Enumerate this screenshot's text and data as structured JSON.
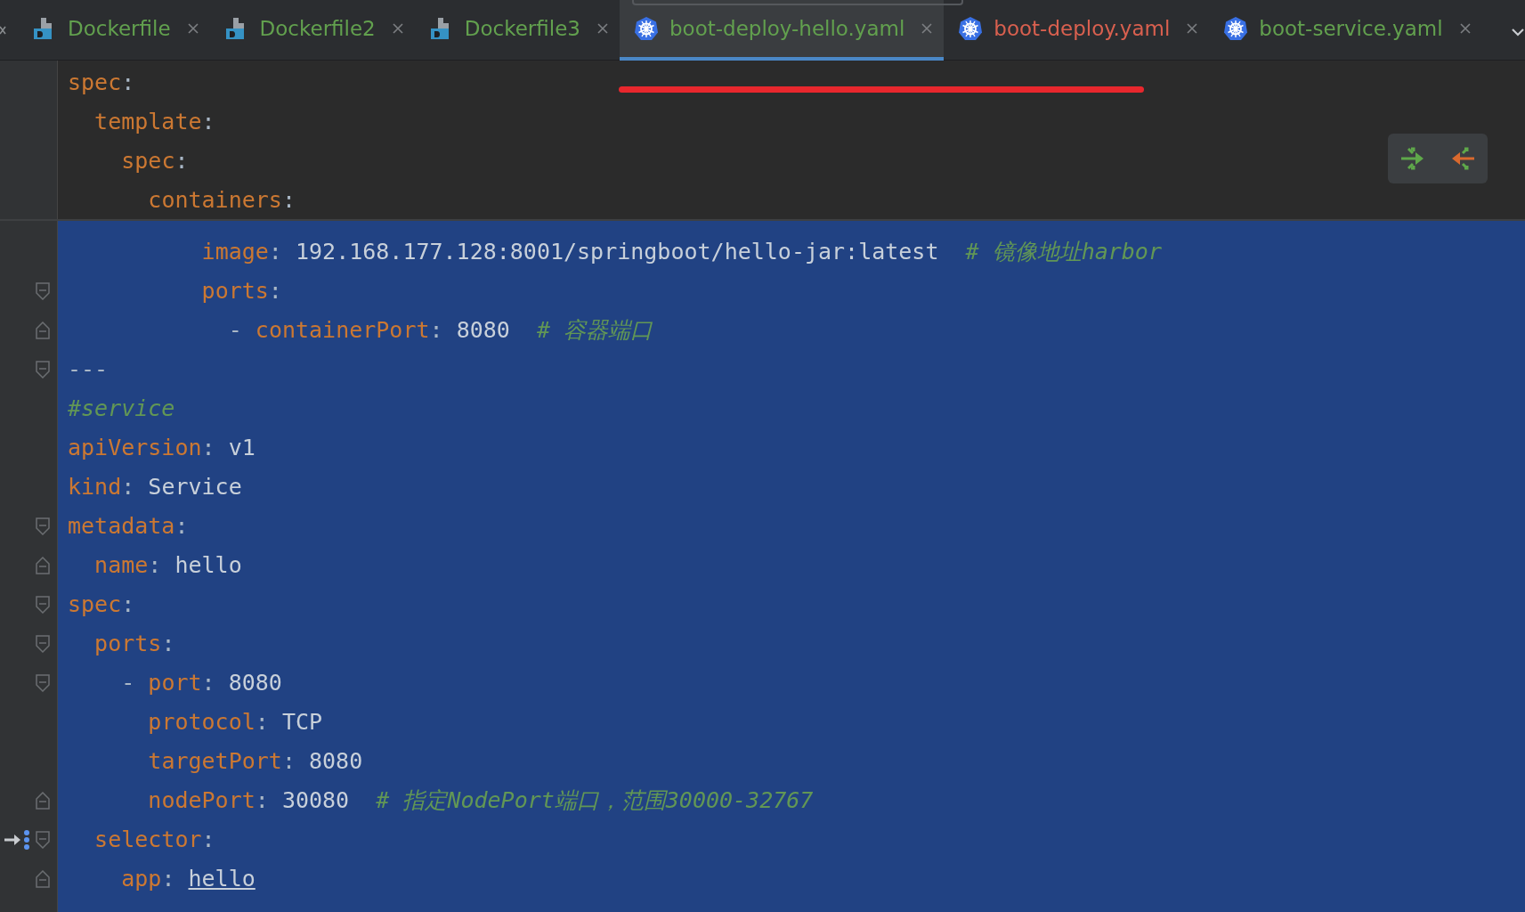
{
  "tabs": [
    {
      "label": "Dockerfile",
      "kind": "docker",
      "color": "#62a04e",
      "selected": false
    },
    {
      "label": "Dockerfile2",
      "kind": "docker",
      "color": "#62a04e",
      "selected": false
    },
    {
      "label": "Dockerfile3",
      "kind": "docker",
      "color": "#62a04e",
      "selected": false
    },
    {
      "label": "boot-deploy-hello.yaml",
      "kind": "kubernetes",
      "color": "#62a04e",
      "selected": true
    },
    {
      "label": "boot-deploy.yaml",
      "kind": "kubernetes",
      "color": "#d9604f",
      "selected": false
    },
    {
      "label": "boot-service.yaml",
      "kind": "kubernetes",
      "color": "#62a04e",
      "selected": false
    }
  ],
  "sticky_header": [
    {
      "tokens": [
        {
          "kind": "key",
          "text": "spec"
        },
        {
          "kind": "punct",
          "text": ":"
        }
      ],
      "children": [
        {
          "tokens": [
            {
              "kind": "key",
              "text": "template"
            },
            {
              "kind": "punct",
              "text": ":"
            }
          ],
          "children": [
            {
              "tokens": [
                {
                  "kind": "key",
                  "text": "spec"
                },
                {
                  "kind": "punct",
                  "text": ":"
                }
              ],
              "children": [
                {
                  "tokens": [
                    {
                      "kind": "key",
                      "text": "containers"
                    },
                    {
                      "kind": "punct",
                      "text": ":"
                    }
                  ]
                }
              ]
            }
          ]
        }
      ]
    }
  ],
  "scrolled_lines": [
    {
      "fold_start": false,
      "fold_end": false,
      "gutter_mark": false,
      "tokens": [
        {
          "kind": "key",
          "text": "image"
        },
        {
          "kind": "punct",
          "text": ":"
        },
        {
          "kind": "value",
          "text": "192.168.177.128:8001/springboot/hello-jar:latest"
        },
        {
          "kind": "comment",
          "text": "# 镜像地址harbor"
        }
      ]
    },
    {
      "fold_start": true,
      "fold_end": false,
      "gutter_mark": false,
      "tokens": [
        {
          "kind": "key",
          "text": "ports"
        },
        {
          "kind": "punct",
          "text": ":"
        }
      ],
      "children": [
        {
          "fold_start": false,
          "fold_end": true,
          "gutter_mark": false,
          "tokens": [
            {
              "kind": "punct",
              "text": "-"
            },
            {
              "kind": "key",
              "text": "containerPort"
            },
            {
              "kind": "punct",
              "text": ":"
            },
            {
              "kind": "value",
              "text": "8080"
            },
            {
              "kind": "comment",
              "text": "# 容器端口"
            }
          ]
        }
      ]
    }
  ],
  "code_lines": [
    {
      "fold_start": true,
      "fold_end": false,
      "gutter_mark": false,
      "tokens": [
        {
          "kind": "punct",
          "text": "---"
        }
      ]
    },
    {
      "fold_start": false,
      "fold_end": false,
      "gutter_mark": false,
      "tokens": [
        {
          "kind": "comment",
          "text": "#service"
        }
      ]
    },
    {
      "fold_start": false,
      "fold_end": false,
      "gutter_mark": false,
      "tokens": [
        {
          "kind": "key",
          "text": "apiVersion"
        },
        {
          "kind": "punct",
          "text": ":"
        },
        {
          "kind": "value",
          "text": "v1"
        }
      ]
    },
    {
      "fold_start": false,
      "fold_end": false,
      "gutter_mark": false,
      "tokens": [
        {
          "kind": "key",
          "text": "kind"
        },
        {
          "kind": "punct",
          "text": ":"
        },
        {
          "kind": "value",
          "text": "Service"
        }
      ]
    },
    {
      "fold_start": true,
      "fold_end": false,
      "gutter_mark": false,
      "tokens": [
        {
          "kind": "key",
          "text": "metadata"
        },
        {
          "kind": "punct",
          "text": ":"
        }
      ],
      "children": [
        {
          "fold_start": false,
          "fold_end": true,
          "gutter_mark": false,
          "tokens": [
            {
              "kind": "key",
              "text": "name"
            },
            {
              "kind": "punct",
              "text": ":"
            },
            {
              "kind": "value",
              "text": "hello"
            }
          ]
        }
      ]
    },
    {
      "fold_start": true,
      "fold_end": false,
      "gutter_mark": false,
      "tokens": [
        {
          "kind": "key",
          "text": "spec"
        },
        {
          "kind": "punct",
          "text": ":"
        }
      ],
      "children": [
        {
          "fold_start": true,
          "fold_end": false,
          "gutter_mark": false,
          "tokens": [
            {
              "kind": "key",
              "text": "ports"
            },
            {
              "kind": "punct",
              "text": ":"
            }
          ],
          "children": [
            {
              "fold_start": true,
              "fold_end": false,
              "gutter_mark": false,
              "tokens": [
                {
                  "kind": "punct",
                  "text": "-"
                },
                {
                  "kind": "key",
                  "text": "port"
                },
                {
                  "kind": "punct",
                  "text": ":"
                },
                {
                  "kind": "value",
                  "text": "8080"
                }
              ],
              "children": [
                {
                  "fold_start": false,
                  "fold_end": false,
                  "gutter_mark": false,
                  "tokens": [
                    {
                      "kind": "key",
                      "text": "protocol"
                    },
                    {
                      "kind": "punct",
                      "text": ":"
                    },
                    {
                      "kind": "value",
                      "text": "TCP"
                    }
                  ]
                },
                {
                  "fold_start": false,
                  "fold_end": false,
                  "gutter_mark": false,
                  "tokens": [
                    {
                      "kind": "key",
                      "text": "targetPort"
                    },
                    {
                      "kind": "punct",
                      "text": ":"
                    },
                    {
                      "kind": "value",
                      "text": "8080"
                    }
                  ]
                },
                {
                  "fold_start": false,
                  "fold_end": true,
                  "gutter_mark": false,
                  "tokens": [
                    {
                      "kind": "key",
                      "text": "nodePort"
                    },
                    {
                      "kind": "punct",
                      "text": ":"
                    },
                    {
                      "kind": "value",
                      "text": "30080"
                    },
                    {
                      "kind": "comment",
                      "text": "# 指定NodePort端口，范围30000-32767"
                    }
                  ]
                }
              ]
            }
          ]
        },
        {
          "fold_start": true,
          "fold_end": false,
          "gutter_mark": true,
          "tokens": [
            {
              "kind": "key",
              "text": "selector"
            },
            {
              "kind": "punct",
              "text": ":"
            }
          ],
          "children": [
            {
              "fold_start": false,
              "fold_end": true,
              "gutter_mark": false,
              "tokens": [
                {
                  "kind": "key",
                  "text": "app"
                },
                {
                  "kind": "punct",
                  "text": ":"
                },
                {
                  "kind": "link",
                  "text": "hello"
                }
              ]
            }
          ]
        }
      ]
    }
  ]
}
